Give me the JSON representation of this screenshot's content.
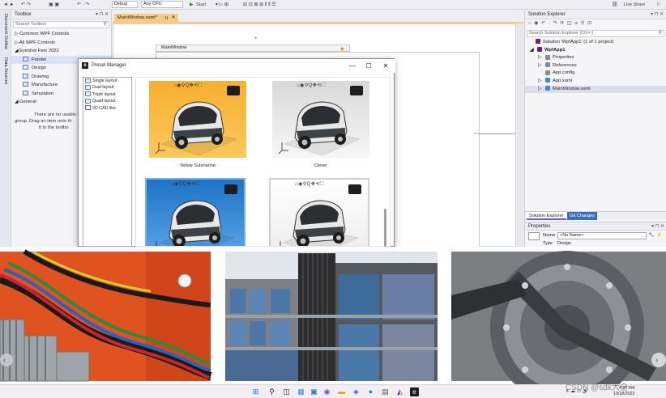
{
  "vs": {
    "toolbar": {
      "config": "Debug",
      "platform": "Any CPU",
      "start": "Start",
      "live_share": "Live Share"
    },
    "left_strip": {
      "doc_outline": "Document Outline",
      "data_sources": "Data Sources"
    },
    "toolbox": {
      "title": "Toolbox",
      "pin": "▾ ⊓ ✕",
      "search_placeholder": "Search Toolbox",
      "items": [
        {
          "label": "Common WPF Controls",
          "prefix": "▷"
        },
        {
          "label": "All WPF Controls",
          "prefix": "▷"
        },
        {
          "label": "Eyeshot Fem 2022",
          "prefix": "◢"
        }
      ],
      "sub_items": [
        "Pointer",
        "Design",
        "Drawing",
        "Manufacture",
        "Simulation"
      ],
      "general": "General",
      "general_prefix": "◢",
      "empty_lines": [
        "There are no usable cont",
        "group. Drag an item onto th",
        "it to the toolbo"
      ]
    },
    "doc_tab": {
      "label": "MainWindow.xaml*",
      "pin": "ɥ",
      "close": "✕"
    },
    "designer": {
      "window_title": "MainWindow"
    },
    "solution": {
      "title": "Solution Explorer",
      "pin": "▾ ⊓ ✕",
      "toolbar": "⌂ ◉ ↶ · ↷ ⟳ ◫ ⟡ ⚲ ⊡",
      "search_placeholder": "Search Solution Explorer (Ctrl+;)",
      "items": [
        {
          "label": "Solution 'WpfApp1' (1 of 1 project)",
          "icon": "solution-icon",
          "indent": 4,
          "prefix": "",
          "sel": false,
          "bold": false
        },
        {
          "label": "WpfApp1",
          "icon": "project-icon",
          "indent": 6,
          "prefix": "◢",
          "sel": false,
          "bold": true
        },
        {
          "label": "Properties",
          "icon": "wrench-icon",
          "indent": 16,
          "prefix": "▷",
          "sel": false,
          "bold": false
        },
        {
          "label": "References",
          "icon": "references-icon",
          "indent": 16,
          "prefix": "▷",
          "sel": false,
          "bold": false
        },
        {
          "label": "App.config",
          "icon": "config-icon",
          "indent": 16,
          "prefix": "",
          "sel": false,
          "bold": false
        },
        {
          "label": "App.xaml",
          "icon": "xaml-icon",
          "indent": 16,
          "prefix": "▷",
          "sel": false,
          "bold": false
        },
        {
          "label": "MainWindow.xaml",
          "icon": "xaml-icon",
          "indent": 16,
          "prefix": "▷",
          "sel": true,
          "bold": false
        }
      ],
      "tab_active": "Solution Explorer",
      "tab_other": "Git Changes"
    },
    "properties": {
      "title": "Properties",
      "pin": "▾ ⊓ ✕",
      "name_label": "Name",
      "name_value": "<No Name>",
      "type_label": "Type",
      "type_value": "Design"
    }
  },
  "dialog": {
    "title": "Preset Manager",
    "logo": "e",
    "minimize": "—",
    "maximize": "☐",
    "close": "✕",
    "layouts": [
      "Single layout",
      "Dual layout",
      "Triple layout",
      "Quad layout",
      "2D CAD like"
    ],
    "presets": [
      {
        "label": "Yellow Submarine",
        "bg": "#f8b02f",
        "bg2": "#fbc85c"
      },
      {
        "label": "Clever",
        "bg": "#d9d9d9",
        "bg2": "#f6f6f6"
      },
      {
        "label": "",
        "bg": "#1f73c6",
        "bg2": "#5aa6e8"
      },
      {
        "label": "",
        "bg": "#ffffff",
        "bg2": "#ececec"
      }
    ],
    "vp_tools": "⌂◉⚲Q✥⟲⛶"
  },
  "gallery": {
    "left_arrow": "‹",
    "right_arrow": "›"
  },
  "taskbar": {
    "time": "4:34 PM",
    "date": "10/18/2022",
    "watermark": "CSDN @sdk大全",
    "tray": "∧ ☁ ▭ 🔊"
  }
}
